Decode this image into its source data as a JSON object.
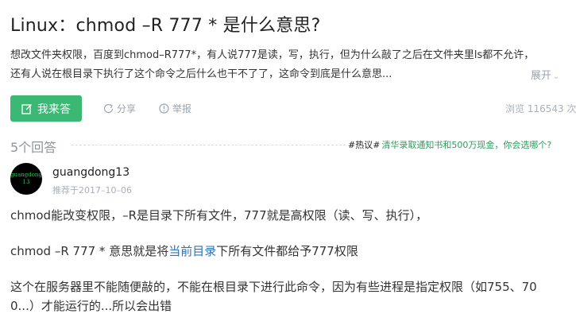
{
  "question": {
    "title": "Linux：chmod –R 777 * 是什么意思?",
    "description_lines": [
      "想改文件夹权限，百度到chmod–R777*，有人说777是读，写，执行，但为什么敲了之后在文件夹里ls都不允许，",
      "还有人说在根目录下执行了这个命令之后什么也干不了了，这命令到底是什么意思..."
    ],
    "expand_label": "展开"
  },
  "actions": {
    "answer_label": "我来答",
    "share_label": "分享",
    "report_label": "举报",
    "views": "浏览 116543 次"
  },
  "answers_header": {
    "count_label": "5个回答",
    "hot_tag": "#热议#",
    "hot_link": "清华录取通知书和500万现金，你会选哪个?"
  },
  "answer": {
    "avatar_text_1": "guangdong",
    "avatar_text_2": "13",
    "username": "guangdong13",
    "recommend": "推荐于2017–10–06",
    "paragraph1": "chmod能改变权限，–R是目录下所有文件，777就是高权限（读、写、执行），",
    "paragraph2_prefix": "chmod –R 777 * 意思就是将",
    "paragraph2_link": "当前目录",
    "paragraph2_suffix": "下所有文件都给予777权限",
    "paragraph3_lines": [
      "这个在服务器里不能随便敲的，不能在根目录下进行此命令，因为有些进程是指定权限（如755、70",
      "0...）才能运行的...所以会出错"
    ]
  },
  "colors": {
    "accent_green": "#3bb873",
    "link_blue": "#2e72b8",
    "hot_green": "#2e9b5c",
    "muted_gray": "#9aa5b1"
  }
}
